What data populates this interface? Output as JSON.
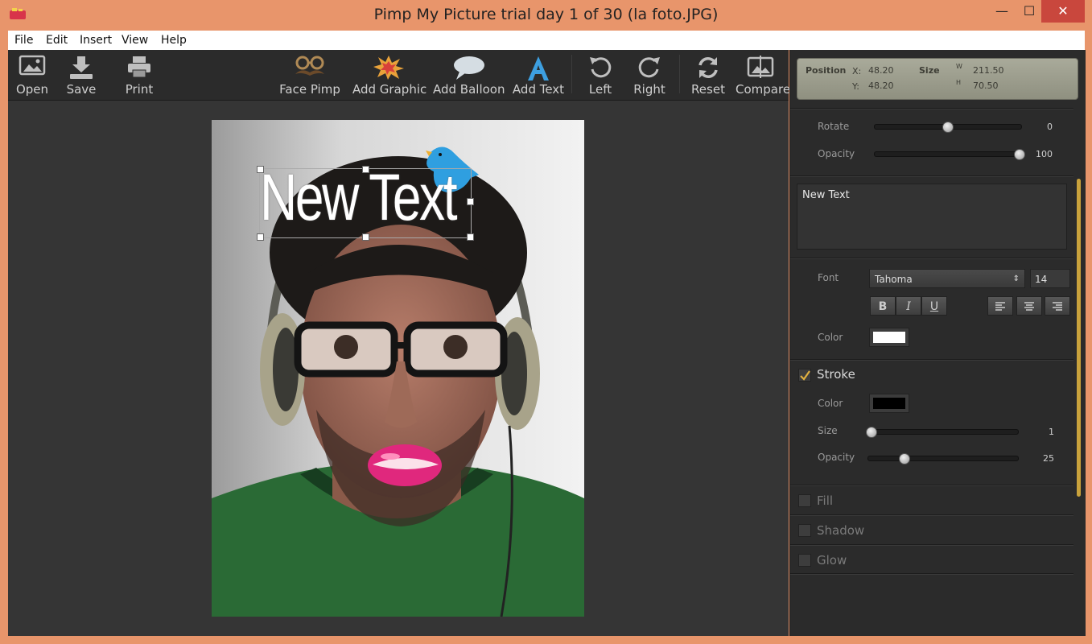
{
  "window": {
    "title": "Pimp My Picture trial day 1 of 30 (la foto.JPG)",
    "minimize": "—",
    "maximize": "☐",
    "close": "✕"
  },
  "menu": [
    "File",
    "Edit",
    "Insert",
    "View",
    "Help"
  ],
  "toolbar": {
    "open": "Open",
    "save": "Save",
    "print": "Print",
    "face_pimp": "Face Pimp",
    "add_graphic": "Add Graphic",
    "add_balloon": "Add Balloon",
    "add_text": "Add Text",
    "left": "Left",
    "right": "Right",
    "reset": "Reset",
    "compare": "Compare"
  },
  "canvas": {
    "overlay_text": "New Text"
  },
  "panel": {
    "position_label": "Position",
    "x_label": "X:",
    "x_value": "48.20",
    "y_label": "Y:",
    "y_value": "48.20",
    "size_label": "Size",
    "w_label": "W",
    "w_value": "211.50",
    "h_label": "H",
    "h_value": "70.50",
    "rotate_label": "Rotate",
    "rotate_value": "0",
    "opacity_label": "Opacity",
    "opacity_value": "100",
    "text_value": "New Text",
    "font_label": "Font",
    "font_value": "Tahoma",
    "font_size_value": "14",
    "bold": "B",
    "italic": "I",
    "underline": "U",
    "color_label": "Color",
    "text_color": "#ffffff",
    "stroke_label": "Stroke",
    "stroke_checked": true,
    "stroke_color_label": "Color",
    "stroke_color": "#000000",
    "stroke_size_label": "Size",
    "stroke_size_value": "1",
    "stroke_opacity_label": "Opacity",
    "stroke_opacity_value": "25",
    "fill_label": "Fill",
    "shadow_label": "Shadow",
    "glow_label": "Glow"
  },
  "colors": {
    "frame": "#e8956b",
    "accent": "#c9a23c",
    "panel_bg": "#2b2b2b",
    "canvas_bg": "#353535"
  }
}
